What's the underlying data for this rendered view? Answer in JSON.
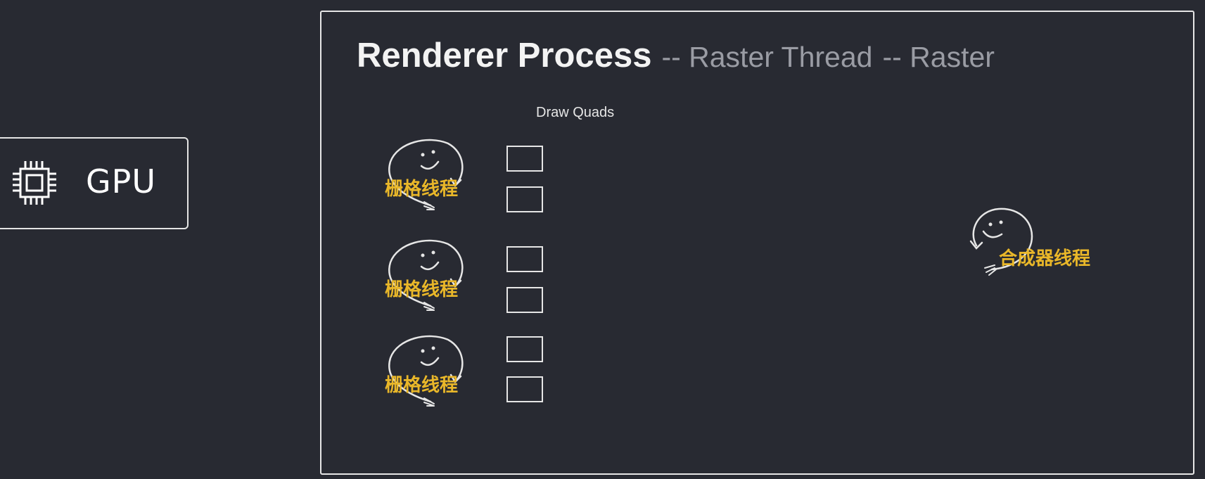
{
  "gpu": {
    "label": "GPU",
    "icon": "cpu-chip-icon"
  },
  "panel": {
    "title": "Renderer Process",
    "subtitle1": "-- Raster Thread",
    "subtitle2": "-- Raster",
    "caption": "Draw Quads"
  },
  "raster_threads": [
    {
      "label": "栅格线程"
    },
    {
      "label": "栅格线程"
    },
    {
      "label": "栅格线程"
    }
  ],
  "compositor_thread": {
    "label": "合成器线程"
  },
  "colors": {
    "background": "#282a32",
    "border": "#e6e6e6",
    "label": "#e9b729",
    "subtitle": "#9a9ca4"
  }
}
